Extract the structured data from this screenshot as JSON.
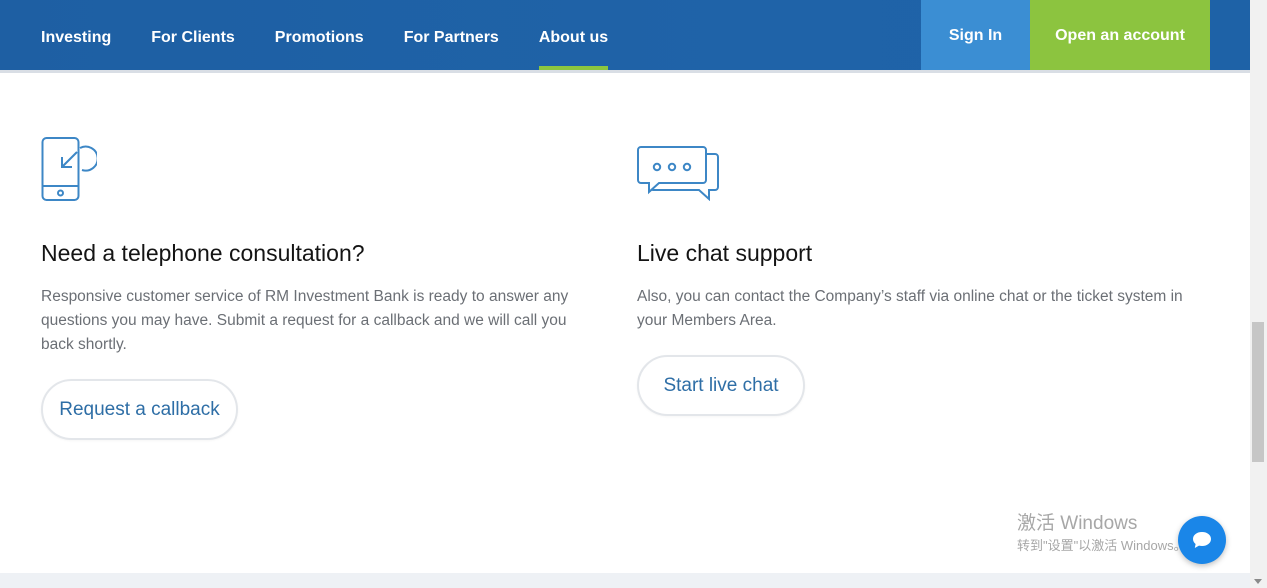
{
  "nav": {
    "items": [
      {
        "label": "Investing"
      },
      {
        "label": "For Clients"
      },
      {
        "label": "Promotions"
      },
      {
        "label": "For Partners"
      },
      {
        "label": "About us",
        "active": true
      }
    ],
    "sign_in": "Sign In",
    "open_account": "Open an account"
  },
  "colors": {
    "nav_bg": "#1e5fa3",
    "active_underline": "#8cc63f",
    "sign_in_bg": "#3b8ed3",
    "open_account_bg": "#8cc43f",
    "button_text": "#2e6ea6"
  },
  "phone_section": {
    "icon": "phone-callback-icon",
    "title": "Need a telephone consultation?",
    "description": "Responsive customer service of RM Investment Bank is ready to answer any questions you may have. Submit a request for a callback and we will call you back shortly.",
    "button": "Request a callback"
  },
  "chat_section": {
    "icon": "chat-bubbles-icon",
    "title": "Live chat support",
    "description": "Also, you can contact the Company’s staff via online chat or the ticket system in your Members Area.",
    "button": "Start live chat"
  },
  "windows_activation": {
    "title": "激活 Windows",
    "subtitle": "转到\"设置\"以激活 Windows。"
  },
  "chat_widget": {
    "icon": "chat-bubble-icon"
  }
}
